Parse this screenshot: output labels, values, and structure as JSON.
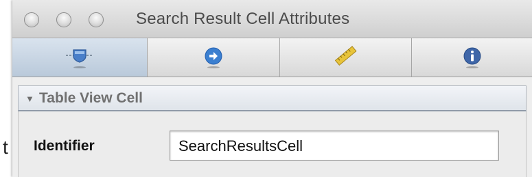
{
  "window": {
    "title": "Search Result Cell Attributes"
  },
  "background_text": "t",
  "toolbar": {
    "tabs": [
      {
        "icon": "object-inspector-icon",
        "selected": true
      },
      {
        "icon": "connections-arrow-icon",
        "selected": false
      },
      {
        "icon": "size-ruler-icon",
        "selected": false
      },
      {
        "icon": "info-icon",
        "selected": false
      }
    ]
  },
  "section": {
    "title": "Table View Cell",
    "expanded": true
  },
  "identifier": {
    "label": "Identifier",
    "value": "SearchResultsCell"
  },
  "colors": {
    "selected_tab": "#c6d3e1",
    "arrow_blue": "#3b7fd0",
    "ruler_yellow": "#e8c43a",
    "info_blue": "#3f66a8"
  }
}
